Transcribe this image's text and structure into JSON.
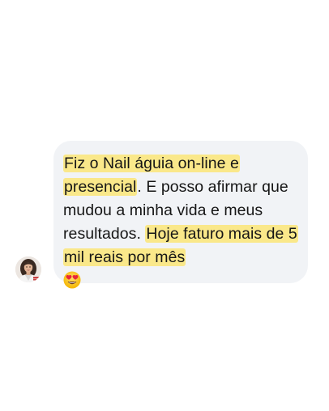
{
  "message": {
    "highlight_1": "Fiz o Nail águia on-line e presencial",
    "plain_1": ". E posso afirmar que mudou a minha vida e meus resultados. ",
    "highlight_2": "Hoje faturo mais de 5 mil reais por mês",
    "emoji": "heart-eyes-emoji",
    "colors": {
      "bubble": "#f1f3f6",
      "highlight": "#fae88a",
      "text": "#161616"
    }
  },
  "sender": {
    "avatar_icon": "profile-photo-avatar"
  }
}
